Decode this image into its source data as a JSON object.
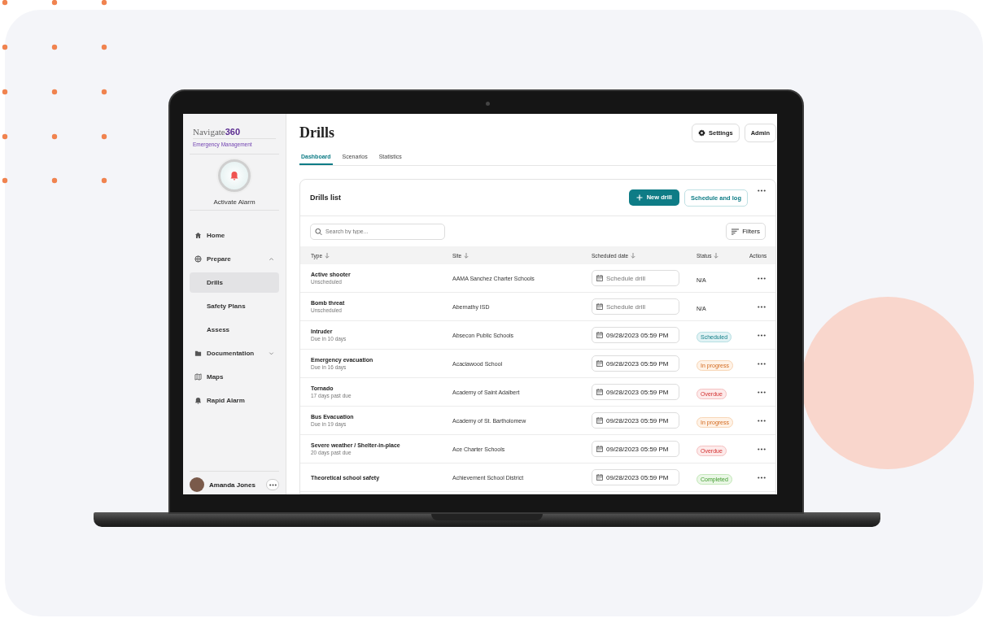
{
  "sidebar": {
    "brand": "Navigate",
    "brand_number": "360",
    "subtitle": "Emergency Management",
    "alarm_label": "Activate Alarm",
    "items": [
      {
        "label": "Home",
        "selected": false
      },
      {
        "label": "Prepare",
        "selected": false,
        "expanded": true,
        "children": [
          {
            "label": "Drills",
            "selected": true
          },
          {
            "label": "Safety Plans",
            "selected": false
          },
          {
            "label": "Assess",
            "selected": false
          }
        ]
      },
      {
        "label": "Documentation",
        "selected": false,
        "expanded": false
      },
      {
        "label": "Maps",
        "selected": false
      },
      {
        "label": "Rapid Alarm",
        "selected": false
      }
    ],
    "user": {
      "name": "Amanda Jones"
    }
  },
  "header": {
    "title": "Drills",
    "buttons": [
      "Settings",
      "Admin"
    ]
  },
  "tabs": [
    {
      "label": "Dashboard",
      "selected": true
    },
    {
      "label": "Scenarios",
      "selected": false
    },
    {
      "label": "Statistics",
      "selected": false
    }
  ],
  "card": {
    "title": "Drills list",
    "primary_button": "New drill",
    "secondary_button": "Schedule and log",
    "search": {
      "placeholder": "Search by type..."
    },
    "filters_button": "Filters"
  },
  "table": {
    "columns": [
      {
        "label": "Type",
        "sortable": true
      },
      {
        "label": "Site",
        "sortable": true
      },
      {
        "label": "Scheduled date",
        "sortable": true
      },
      {
        "label": "Status",
        "sortable": true
      },
      {
        "label": "Actions",
        "sortable": false
      }
    ],
    "rows": [
      {
        "type": "Active shooter",
        "due": "Unscheduled",
        "site": "AAMA Sanchez Charter Schools",
        "date": {
          "placeholder": "Schedule drill"
        },
        "status": {
          "label": "N/A",
          "kind": "none"
        }
      },
      {
        "type": "Bomb threat",
        "due": "Unscheduled",
        "site": "Abernathy ISD",
        "date": {
          "placeholder": "Schedule drill"
        },
        "status": {
          "label": "N/A",
          "kind": "none"
        }
      },
      {
        "type": "Intruder",
        "due": "Due in 10 days",
        "site": "Absecon Public Schools",
        "date": {
          "value": "09/28/2023 05:59 PM"
        },
        "status": {
          "label": "Scheduled",
          "kind": "scheduled"
        }
      },
      {
        "type": "Emergency evacuation",
        "due": "Due in 16 days",
        "site": "Acaciawood School",
        "date": {
          "value": "09/28/2023 05:59 PM"
        },
        "status": {
          "label": "In progress",
          "kind": "progress"
        }
      },
      {
        "type": "Tornado",
        "due": "17 days past due",
        "site": "Academy of Saint Adalbert",
        "date": {
          "value": "09/28/2023 05:59 PM"
        },
        "status": {
          "label": "Overdue",
          "kind": "overdue"
        }
      },
      {
        "type": "Bus Evacuation",
        "due": "Due in 19 days",
        "site": "Academy of St. Bartholomew",
        "date": {
          "value": "09/28/2023 05:59 PM"
        },
        "status": {
          "label": "In progress",
          "kind": "progress"
        }
      },
      {
        "type": "Severe weather / Shelter-in-place",
        "due": "20 days past due",
        "site": "Ace Charter Schools",
        "date": {
          "value": "09/28/2023 05:59 PM"
        },
        "status": {
          "label": "Overdue",
          "kind": "overdue"
        }
      },
      {
        "type": "Theoretical school safety",
        "site": "Achievement School District",
        "date": {
          "value": "09/28/2023 05:59 PM"
        },
        "status": {
          "label": "Completed",
          "kind": "completed"
        }
      }
    ]
  }
}
